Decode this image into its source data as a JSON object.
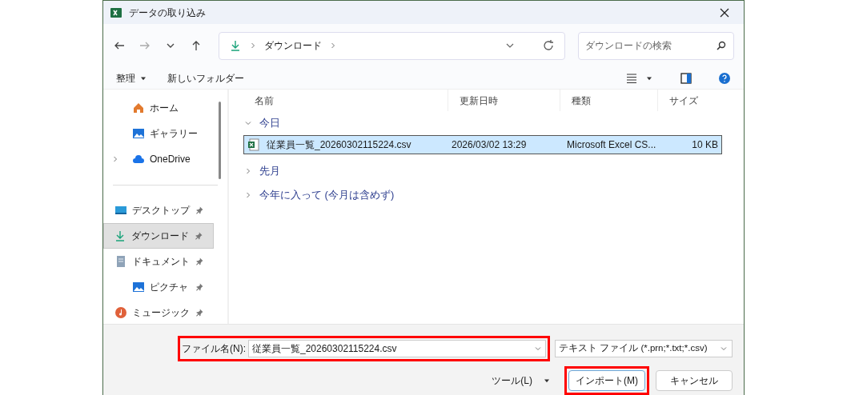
{
  "window": {
    "title": "データの取り込み"
  },
  "address": {
    "path": [
      "ダウンロード"
    ]
  },
  "search": {
    "placeholder": "ダウンロードの検索"
  },
  "toolbar": {
    "organize": "整理",
    "new_folder": "新しいフォルダー"
  },
  "sidebar": {
    "items": [
      {
        "kind": "home",
        "label": "ホーム",
        "pinned": false,
        "selected": false,
        "expandable": false
      },
      {
        "kind": "gallery",
        "label": "ギャラリー",
        "pinned": false,
        "selected": false,
        "expandable": false
      },
      {
        "kind": "cloud",
        "label": "OneDrive",
        "pinned": false,
        "selected": false,
        "expandable": true
      },
      {
        "kind": "divider"
      },
      {
        "kind": "desktop",
        "label": "デスクトップ",
        "pinned": true,
        "selected": false,
        "expandable": false
      },
      {
        "kind": "download",
        "label": "ダウンロード",
        "pinned": true,
        "selected": true,
        "expandable": false
      },
      {
        "kind": "document",
        "label": "ドキュメント",
        "pinned": true,
        "selected": false,
        "expandable": false
      },
      {
        "kind": "pictures",
        "label": "ピクチャ",
        "pinned": true,
        "selected": false,
        "expandable": false
      },
      {
        "kind": "music",
        "label": "ミュージック",
        "pinned": true,
        "selected": false,
        "expandable": false
      }
    ]
  },
  "table": {
    "columns": [
      "名前",
      "更新日時",
      "種類",
      "サイズ"
    ],
    "groups": [
      {
        "label": "今日",
        "expanded": true,
        "files": [
          {
            "name": "従業員一覧_20260302115224.csv",
            "modified": "2026/03/02 13:29",
            "type": "Microsoft Excel CS...",
            "size": "10 KB",
            "selected": true
          }
        ]
      },
      {
        "label": "先月",
        "expanded": false
      },
      {
        "label": "今年に入って (今月は含めず)",
        "expanded": false
      }
    ]
  },
  "footer": {
    "filename_label": "ファイル名(N):",
    "filename_value": "従業員一覧_20260302115224.csv",
    "filename_highlighted": true,
    "filetype": "テキスト ファイル (*.prn;*.txt;*.csv)",
    "tools": "ツール(L)",
    "import": "インポート(M)",
    "import_highlighted": true,
    "cancel": "キャンセル"
  }
}
